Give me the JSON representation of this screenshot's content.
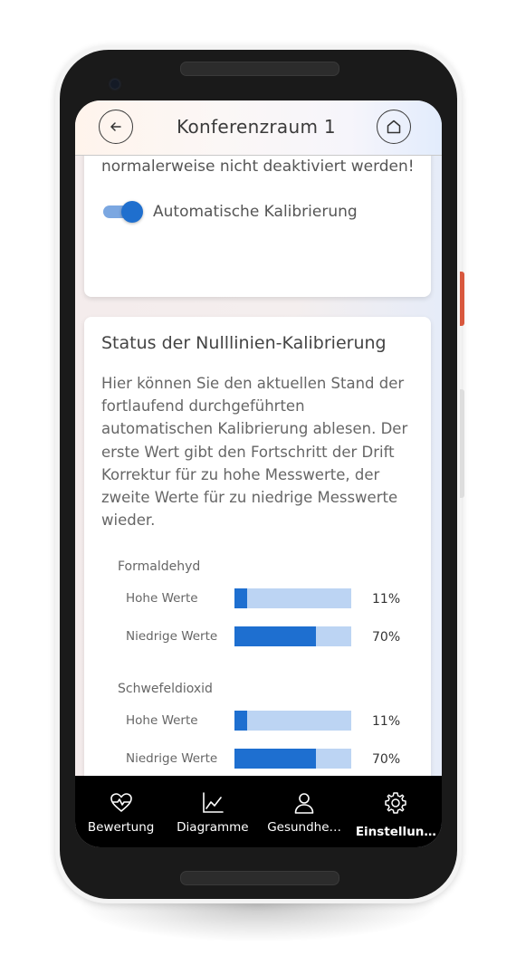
{
  "app": {
    "title": "Konferenzraum 1"
  },
  "card1": {
    "warning_text": "normalerweise nicht deaktiviert werden!",
    "toggle_label": "Automatische Kalibrierung",
    "toggle_on": true
  },
  "card2": {
    "title": "Status der Nulllinien-Kalibrierung",
    "description": "Hier können Sie den aktuellen Stand der fortlaufend durchgeführten automatischen Kalibrierung ablesen. Der erste Wert gibt den Fortschritt der Drift Korrektur für zu hohe Messwerte, der zweite Werte für zu niedrige Messwerte wieder.",
    "groups": [
      {
        "name": "Formaldehyd",
        "rows": [
          {
            "label": "Hohe Werte",
            "percent": 11,
            "display": "11%"
          },
          {
            "label": "Niedrige Werte",
            "percent": 70,
            "display": "70%"
          }
        ]
      },
      {
        "name": "Schwefeldioxid",
        "rows": [
          {
            "label": "Hohe Werte",
            "percent": 11,
            "display": "11%"
          },
          {
            "label": "Niedrige Werte",
            "percent": 70,
            "display": "70%"
          }
        ]
      }
    ]
  },
  "nav": {
    "items": [
      {
        "label": "Bewertung",
        "icon": "heart-pulse-icon",
        "active": false
      },
      {
        "label": "Diagramme",
        "icon": "line-chart-icon",
        "active": false
      },
      {
        "label": "Gesundhe…",
        "icon": "person-icon",
        "active": false
      },
      {
        "label": "Einstellun…",
        "icon": "gear-icon",
        "active": true
      }
    ]
  },
  "colors": {
    "accent": "#1e6fd0",
    "bar_track": "#bcd4f3",
    "toggle_track": "#7ba7e1",
    "nav_background": "#000000"
  }
}
